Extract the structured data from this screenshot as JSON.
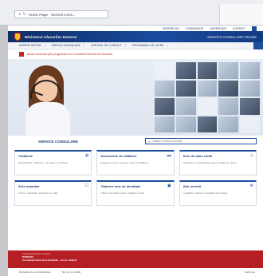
{
  "browser": {
    "address": "Home Page - Servicii Cons..."
  },
  "utility": [
    "Despre noi",
    "Comunicate",
    "Acreditari",
    "Contact"
  ],
  "header": {
    "brand": "Ministerul Afacerilor Externe",
    "right": "Servicii Consulare Online"
  },
  "nav": [
    "Despre sistem",
    "Servicii consulare",
    "Centrul de contact",
    "Programul de lucru"
  ],
  "alert": {
    "text": "Acces securizat prin programare la Consulatul General al României"
  },
  "section": {
    "title": "Servicii consulare",
    "search_placeholder": "Căutare serviciu consular"
  },
  "cards": [
    {
      "title": "Cetățenie",
      "icon": "globe-icon",
      "desc": "Redobândire, dobândire, renunțare și certificat."
    },
    {
      "title": "Documente de călătorie",
      "icon": "passport-icon",
      "desc": "Pașaport simplu, temporar și titlu de călătorie."
    },
    {
      "title": "Acte de stare civilă",
      "icon": "rings-icon",
      "desc": "Transcriere certificate de naștere, căsătorie, deces."
    },
    {
      "title": "Acte notariale",
      "icon": "document-icon",
      "desc": "Procuri, declarații, certificate de viață."
    },
    {
      "title": "Obținere acte de identitate",
      "icon": "id-card-icon",
      "desc": "Cărți de identitate pentru cetățenii români."
    },
    {
      "title": "Alte servicii",
      "icon": "gear-icon",
      "desc": "Legalizări, traduceri, apostilări documente."
    }
  ],
  "footer": {
    "line1": "Adresă poștală și program",
    "line2": "ROMÂNIA",
    "line3": "Consulatul General al României - acces cetățeni"
  },
  "subfooter": [
    "Declarație de confidențialitate",
    "Termeni și condiții",
    "Hartă site"
  ]
}
